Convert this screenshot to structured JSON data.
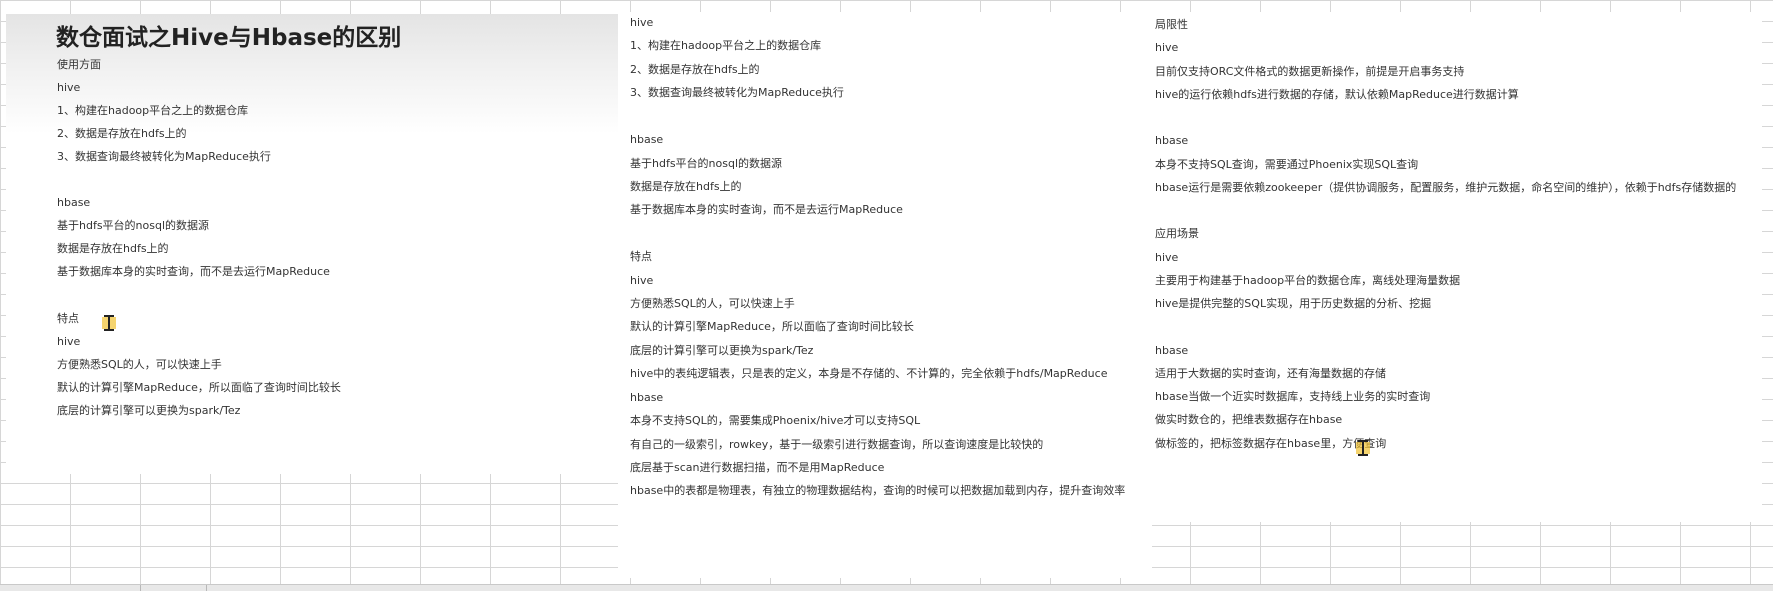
{
  "title": "数仓面试之Hive与Hbase的区别",
  "col1": [
    "使用方面",
    "hive",
    "1、构建在hadoop平台之上的数据仓库",
    "2、数据是存放在hdfs上的",
    "3、数据查询最终被转化为MapReduce执行",
    "",
    "hbase",
    "基于hdfs平台的nosql的数据源",
    "数据是存放在hdfs上的",
    "基于数据库本身的实时查询，而不是去运行MapReduce",
    "",
    "特点",
    "hive",
    "方便熟悉SQL的人，可以快速上手",
    "默认的计算引擎MapReduce，所以面临了查询时间比较长",
    "底层的计算引擎可以更换为spark/Tez"
  ],
  "col2": [
    "hive",
    "1、构建在hadoop平台之上的数据仓库",
    "2、数据是存放在hdfs上的",
    "3、数据查询最终被转化为MapReduce执行",
    "",
    "hbase",
    "基于hdfs平台的nosql的数据源",
    "数据是存放在hdfs上的",
    "基于数据库本身的实时查询，而不是去运行MapReduce",
    "",
    "特点",
    "hive",
    "方便熟悉SQL的人，可以快速上手",
    "默认的计算引擎MapReduce，所以面临了查询时间比较长",
    "底层的计算引擎可以更换为spark/Tez",
    "hive中的表纯逻辑表，只是表的定义，本身是不存储的、不计算的，完全依赖于hdfs/MapReduce",
    "hbase",
    "本身不支持SQL的，需要集成Phoenix/hive才可以支持SQL",
    "有自己的一级索引，rowkey，基于一级索引进行数据查询，所以查询速度是比较快的",
    "底层基于scan进行数据扫描，而不是用MapReduce",
    "hbase中的表都是物理表，有独立的物理数据结构，查询的时候可以把数据加载到内存，提升查询效率"
  ],
  "col3": [
    "局限性",
    "hive",
    "目前仅支持ORC文件格式的数据更新操作，前提是开启事务支持",
    "hive的运行依赖hdfs进行数据的存储，默认依赖MapReduce进行数据计算",
    "",
    "hbase",
    "本身不支持SQL查询，需要通过Phoenix实现SQL查询",
    "hbase运行是需要依赖zookeeper（提供协调服务，配置服务，维护元数据，命名空间的维护），依赖于hdfs存储数据的",
    "",
    "应用场景",
    "hive",
    "主要用于构建基于hadoop平台的数据仓库，离线处理海量数据",
    "hive是提供完整的SQL实现，用于历史数据的分析、挖掘",
    "",
    "hbase",
    "适用于大数据的实时查询，还有海量数据的存储",
    "hbase当做一个近实时数据库，支持线上业务的实时查询",
    "做实时数仓的，把维表数据存在hbase",
    "做标签的，把标签数据存在hbase里，方便查询"
  ]
}
